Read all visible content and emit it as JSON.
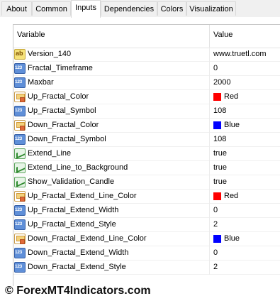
{
  "tabs": [
    "About",
    "Common",
    "Inputs",
    "Dependencies",
    "Colors",
    "Visualization"
  ],
  "grid": {
    "header": {
      "variable": "Variable",
      "value": "Value"
    },
    "rows": [
      {
        "name": "Version_140",
        "value": "www.truetl.com",
        "type": "string",
        "icon": "string-icon"
      },
      {
        "name": "Fractal_Timeframe",
        "value": "0",
        "type": "int",
        "icon": "integer-icon"
      },
      {
        "name": "Maxbar",
        "value": "2000",
        "type": "int",
        "icon": "integer-icon"
      },
      {
        "name": "Up_Fractal_Color",
        "value": "Red",
        "type": "color",
        "icon": "color-icon",
        "color": "#ff0000"
      },
      {
        "name": "Up_Fractal_Symbol",
        "value": "108",
        "type": "int",
        "icon": "integer-icon"
      },
      {
        "name": "Down_Fractal_Color",
        "value": "Blue",
        "type": "color",
        "icon": "color-icon",
        "color": "#0000ff"
      },
      {
        "name": "Down_Fractal_Symbol",
        "value": "108",
        "type": "int",
        "icon": "integer-icon"
      },
      {
        "name": "Extend_Line",
        "value": "true",
        "type": "bool",
        "icon": "boolean-icon"
      },
      {
        "name": "Extend_Line_to_Background",
        "value": "true",
        "type": "bool",
        "icon": "boolean-icon"
      },
      {
        "name": "Show_Validation_Candle",
        "value": "true",
        "type": "bool",
        "icon": "boolean-icon"
      },
      {
        "name": "Up_Fractal_Extend_Line_Color",
        "value": "Red",
        "type": "color",
        "icon": "color-icon",
        "color": "#ff0000"
      },
      {
        "name": "Up_Fractal_Extend_Width",
        "value": "0",
        "type": "int",
        "icon": "integer-icon"
      },
      {
        "name": "Up_Fractal_Extend_Style",
        "value": "2",
        "type": "int",
        "icon": "integer-icon"
      },
      {
        "name": "Down_Fractal_Extend_Line_Color",
        "value": "Blue",
        "type": "color",
        "icon": "color-icon",
        "color": "#0000ff"
      },
      {
        "name": "Down_Fractal_Extend_Width",
        "value": "0",
        "type": "int",
        "icon": "integer-icon"
      },
      {
        "name": "Down_Fractal_Extend_Style",
        "value": "2",
        "type": "int",
        "icon": "integer-icon"
      }
    ]
  },
  "watermark": "© ForexMT4Indicators.com"
}
